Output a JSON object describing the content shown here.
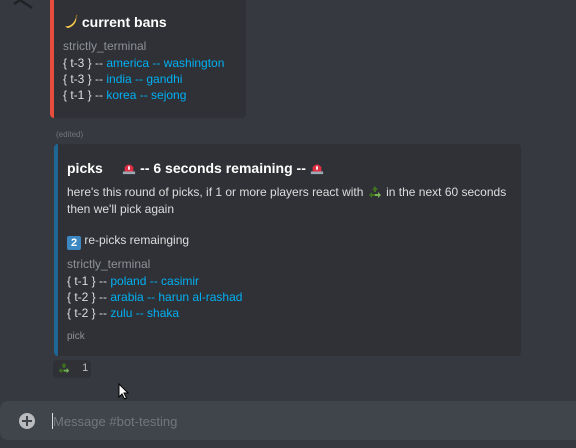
{
  "colors": {
    "background": "#36393f",
    "embed_background": "#2f3136",
    "bans_accent": "#e74c3c",
    "picks_accent": "#206694",
    "link": "#00b0f4"
  },
  "bans_embed": {
    "icon": "banana-emoji",
    "title": "current bans",
    "author": "strictly_terminal",
    "entries": [
      {
        "tier": "{ t-3 } --",
        "civ": "america -- washington"
      },
      {
        "tier": "{ t-3 } --",
        "civ": "india -- gandhi"
      },
      {
        "tier": "{ t-1 } --",
        "civ": "korea -- sejong"
      }
    ]
  },
  "edited_label": "(edited)",
  "picks_embed": {
    "title": "picks",
    "timer": "-- 6 seconds remaining --",
    "timer_icon": "siren-emoji",
    "description_1": "here's this round of picks, if 1 or more players react with",
    "description_icon": "recycle-emoji",
    "description_2": "in the next 60 seconds",
    "description_3": "then we'll pick again",
    "repicks_number": "2",
    "repicks_label": "re-picks remainging",
    "author": "strictly_terminal",
    "entries": [
      {
        "tier": "{ t-1 } --",
        "civ": "poland -- casimir"
      },
      {
        "tier": "{ t-2 } --",
        "civ": "arabia -- harun al-rashad"
      },
      {
        "tier": "{ t-2 } --",
        "civ": "zulu -- shaka"
      }
    ],
    "footer": "pick"
  },
  "reaction": {
    "icon": "recycle-emoji",
    "count": "1"
  },
  "composer": {
    "placeholder": "Message #bot-testing"
  }
}
